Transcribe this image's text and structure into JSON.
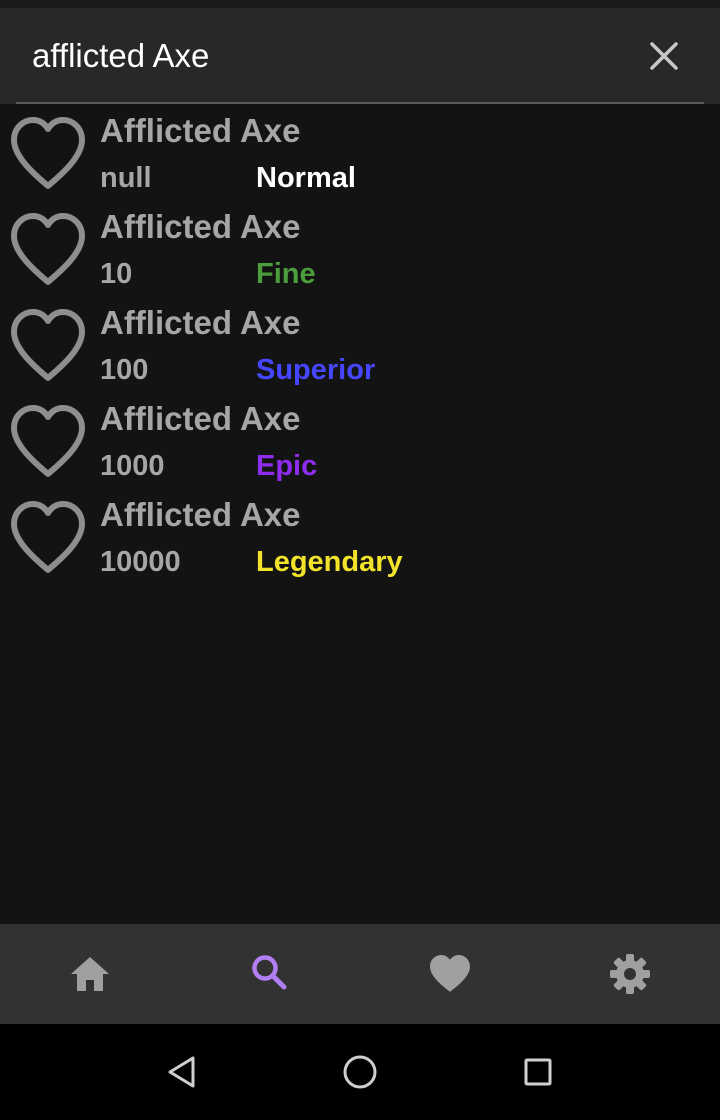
{
  "search": {
    "query": "afflicted Axe",
    "clear_icon": "close-icon"
  },
  "colors": {
    "background": "#131313",
    "search_bar": "#282828",
    "nav_bar": "#323232",
    "nav_active": "#b07ff2",
    "nav_inactive": "#a0a0a0"
  },
  "results": [
    {
      "name": "Afflicted Axe",
      "value": "null",
      "rarity": "Normal",
      "rarity_color": "#ffffff"
    },
    {
      "name": "Afflicted Axe",
      "value": "10",
      "rarity": "Fine",
      "rarity_color": "#4a9e3c"
    },
    {
      "name": "Afflicted Axe",
      "value": "100",
      "rarity": "Superior",
      "rarity_color": "#4646ff"
    },
    {
      "name": "Afflicted Axe",
      "value": "1000",
      "rarity": "Epic",
      "rarity_color": "#8e2cf0"
    },
    {
      "name": "Afflicted Axe",
      "value": "10000",
      "rarity": "Legendary",
      "rarity_color": "#f2e22b"
    }
  ],
  "bottom_nav": [
    {
      "id": "home",
      "icon": "home-icon",
      "active": false
    },
    {
      "id": "search",
      "icon": "search-icon",
      "active": true
    },
    {
      "id": "favorites",
      "icon": "heart-icon",
      "active": false
    },
    {
      "id": "settings",
      "icon": "gear-icon",
      "active": false
    }
  ],
  "system_nav": [
    "back-icon",
    "home-circle-icon",
    "recents-icon"
  ]
}
